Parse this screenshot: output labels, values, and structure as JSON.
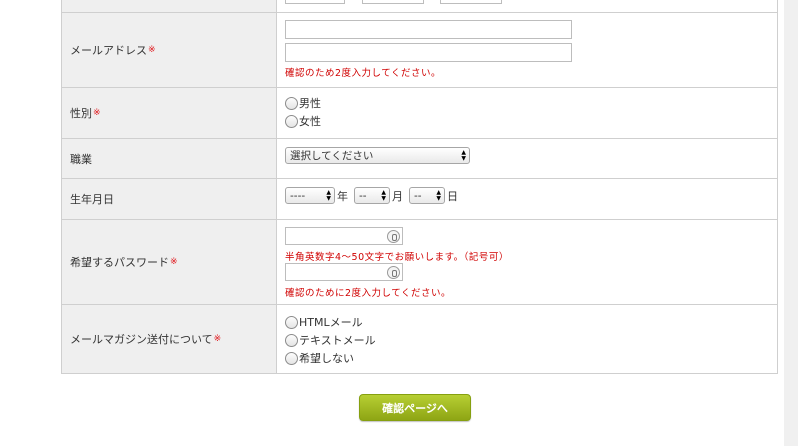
{
  "form": {
    "email": {
      "label": "メールアドレス",
      "required_mark": "※",
      "note": "確認のため2度入力してください。"
    },
    "gender": {
      "label": "性別",
      "required_mark": "※",
      "options": [
        "男性",
        "女性"
      ]
    },
    "occupation": {
      "label": "職業",
      "select_value": "選択してください"
    },
    "birthday": {
      "label": "生年月日",
      "year_value": "----",
      "year_suffix": "年",
      "month_value": "--",
      "month_suffix": "月",
      "day_value": "--",
      "day_suffix": "日"
    },
    "password": {
      "label": "希望するパスワード",
      "required_mark": "※",
      "note1": "半角英数字4～50文字でお願いします。（記号可）",
      "note2": "確認のために2度入力してください。"
    },
    "newsletter": {
      "label": "メールマガジン送付について",
      "required_mark": "※",
      "options": [
        "HTMLメール",
        "テキストメール",
        "希望しない"
      ]
    }
  },
  "submit_label": "確認ページへ"
}
